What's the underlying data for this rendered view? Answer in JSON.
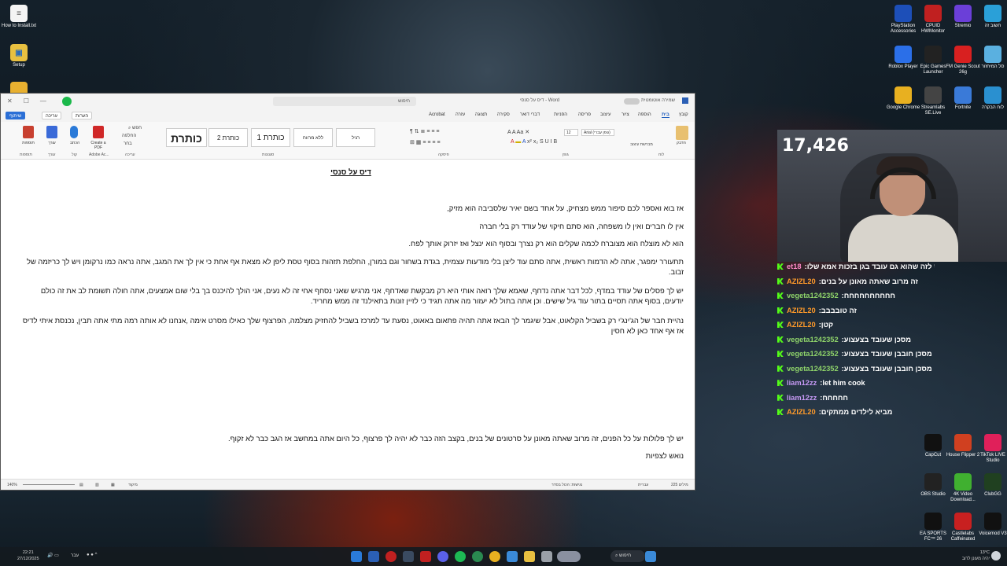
{
  "desktop_icons_left": [
    {
      "label": "How to Install.txt",
      "icon": "text-file-icon",
      "color": "#ffffff"
    },
    {
      "label": "Setup",
      "icon": "setup-folder-icon",
      "color": "#3a9be8"
    }
  ],
  "desktop_icons_right": [
    {
      "label": "PlayStation Accessories",
      "icon": "playstation-icon",
      "color": "#1d4fb8"
    },
    {
      "label": "CPUID HWMonitor",
      "icon": "hwmonitor-icon",
      "color": "#c02020"
    },
    {
      "label": "Stremio",
      "icon": "stremio-icon",
      "color": "#6b3fd8"
    },
    {
      "label": "חשוב זה",
      "icon": "folder-icon",
      "color": "#2aa0d8"
    },
    {
      "label": "Roblox Player",
      "icon": "roblox-icon",
      "color": "#2b6fe8"
    },
    {
      "label": "Epic Games Launcher",
      "icon": "epic-games-icon",
      "color": "#222222"
    },
    {
      "label": "FM Genie Scout 26g",
      "icon": "fm-genie-icon",
      "color": "#d82020"
    },
    {
      "label": "סל המיחזור",
      "icon": "recycle-bin-icon",
      "color": "#5ab0e0"
    },
    {
      "label": "Google Chrome",
      "icon": "chrome-icon",
      "color": "#e8b020"
    },
    {
      "label": "Streamlabs SE.Live",
      "icon": "streamlabs-icon",
      "color": "#444444"
    },
    {
      "label": "Fortnite",
      "icon": "fortnite-icon",
      "color": "#3a7ad8"
    },
    {
      "label": "לוח הבקרה",
      "icon": "control-panel-icon",
      "color": "#2a90d0"
    }
  ],
  "desktop_icons_right_lower": [
    {
      "label": "CapCut",
      "icon": "capcut-icon",
      "color": "#111111"
    },
    {
      "label": "House Flipper 2",
      "icon": "house-flipper-icon",
      "color": "#d04020"
    },
    {
      "label": "TikTok LIVE Studio",
      "icon": "tiktok-icon",
      "color": "#e0205a"
    },
    {
      "label": "OBS Studio",
      "icon": "obs-icon",
      "color": "#222222"
    },
    {
      "label": "4K Video Download...",
      "icon": "4k-video-icon",
      "color": "#40b030"
    },
    {
      "label": "ClubGG",
      "icon": "clubgg-icon",
      "color": "#204020"
    },
    {
      "label": "EA SPORTS FC™ 26",
      "icon": "ea-fc-icon",
      "color": "#111111"
    },
    {
      "label": "Castlelabs Caffeinated",
      "icon": "castlelabs-icon",
      "color": "#c82020"
    },
    {
      "label": "Voicemod V3",
      "icon": "voicemod-icon",
      "color": "#111111"
    }
  ],
  "word": {
    "search_placeholder": "חיפוש",
    "doc_title": "דיס על סנסי - Word",
    "autosave": "שמירה אוטומטית",
    "tabs": [
      "קובץ",
      "בית",
      "הוספה",
      "ציור",
      "עיצוב",
      "פריסה",
      "הפניות",
      "דברי דואר",
      "סקירה",
      "תצוגה",
      "עזרה",
      "Acrobat"
    ],
    "active_tab": "בית",
    "buttons": {
      "comments": "הערות",
      "editing": "עריכה",
      "share": "שיתוף"
    },
    "ribbon": {
      "groups": [
        "לוח",
        "גופן",
        "פיסקה",
        "סגנונות",
        "עריכה",
        "Adobe Ac...",
        "קול",
        "עורך",
        "תוספות"
      ],
      "font_name": "Arial (גופן עברי)",
      "font_size": "12",
      "styles": [
        "רגיל",
        "ללא מרווח",
        "כותרת 1",
        "כותרת 2",
        "כותרת"
      ],
      "paste": "הדבק",
      "format_painter": "מברשת עיצוב",
      "find": "חפש",
      "replace": "החלפה",
      "select": "בחר",
      "create_pdf": "Create a PDF",
      "dictate": "הכתב",
      "editor": "עורך",
      "addins": "תוספות"
    },
    "document": {
      "title": "דיס על סנסי",
      "paragraphs": [
        "אז בוא ואספר לכם סיפור ממש מצחיק, על אחד בשם יאיר שלסביבה הוא מזיק,",
        "אין לו חברים ואין לו משפחה, הוא סתם חיקוי של עודד רק בלי חברה",
        "הוא לא מוצלח הוא מצוברח לכמה שקלים הוא רק נצרך ובסוף הוא ינצל ואז יזרוק אותך לפח.",
        "תתעורר ימפגר, אתה לא הדמות ראשית, אתה סתם עוד ליצן בלי מודעות עצמית, בגדת בשחור וגם במורן, החלפת תזהות בסוף טסת ליפן לא מצאת אף אחת כי אין לך את המגב, אתה נראה כמו נרקומן ויש לך כריזמה של זבוב.",
        "יש לך פסלים של עודד במדף, לכל דבר אתה נדחף, שאמא שלך רואה אותי היא רק מבקשת שאדחף, אני מרגיש שאני נסחף אחי זה לא נעים, אני הולך להיכנס בך בלי שום אמצעים, אתה חולה תשומת לב את זה כולם יודעים, בסוף אתה תסיים בתור עוד גיל שישים. וכן אתה בתול לא יעזור מה אתה תגיד כי לזיין זונות בתאילנד זה ממש מחריד.",
        "נהיית חבר של הג'ינג'י רק בשביל הקלאוט, אבל שיגמר לך הבאז אתה תהיה פתאום באאוט, נסעת עד למרכז בשביל להחזיק מצלמה, הפרצוף שלך כאילו מסרט אימה ,אנחנו לא אותה רמה מתי אתה תבין, נכנסת איתי לדיס אז אף אחד כאן לא חסין",
        "יש לך פלולות על כל הפנים, זה מרוב שאתה מאונן על סרטונים של בנים, בקצב הזה כבר לא יהיה לך פרצוף, כל היום אתה במחשב אז הגב כבר לא זקוף.",
        "נואש לצפיות"
      ]
    },
    "statusbar": {
      "page_info": "225 מילים",
      "language": "עברית",
      "accessibility": "נגישות: הכול בסדר",
      "focus": "מיקוד",
      "zoom": "140%"
    }
  },
  "stream": {
    "viewer_count": "17,426",
    "chat": [
      {
        "user": "et18",
        "text": "ותתייחס לזה שהוא גם עובד בגן בזכות אמא שלו",
        "color": "#ff8ac8"
      },
      {
        "user": "AZIZL20",
        "text": "זה מרוב שאתה מאונן על בנים",
        "color": "#ff9a2a"
      },
      {
        "user": "vegeta1242352",
        "text": "חחחחחחחחחח",
        "color": "#8fd46a"
      },
      {
        "user": "AZIZL20",
        "text": "זה טובבבב",
        "color": "#ff9a2a"
      },
      {
        "user": "AZIZL20",
        "text": "קטן",
        "color": "#ff9a2a"
      },
      {
        "user": "vegeta1242352",
        "text": "מסכן שעובד בצעצוע",
        "color": "#8fd46a"
      },
      {
        "user": "vegeta1242352",
        "text": "מסכן חובבן שעובד בצעצוע",
        "color": "#8fd46a"
      },
      {
        "user": "vegeta1242352",
        "text": "מסכן חובבן שעובד בצעצוע",
        "color": "#8fd46a"
      },
      {
        "user": "liam12zz",
        "text": "let him cook",
        "color": "#c79af5"
      },
      {
        "user": "liam12zz",
        "text": "חחחחח",
        "color": "#c79af5"
      },
      {
        "user": "AZIZL20",
        "text": "מביא לילדים ממתקים",
        "color": "#ff9a2a"
      }
    ]
  },
  "taskbar": {
    "search": "חיפוש",
    "time": "22:21",
    "date": "27/12/2025",
    "lang": "עבר",
    "weather_temp": "13°C",
    "weather_text": "יהיה מעונן לרוב"
  }
}
